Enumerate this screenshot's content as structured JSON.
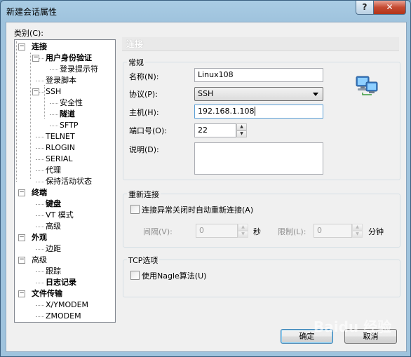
{
  "window": {
    "title": "新建会话属性",
    "help_glyph": "?",
    "close_glyph": "✕"
  },
  "category_label": "类别(C):",
  "tree": {
    "items": [
      {
        "label": "连接",
        "bold": true
      },
      {
        "label": "用户身份验证",
        "bold": true
      },
      {
        "label": "登录提示符",
        "bold": false
      },
      {
        "label": "登录脚本",
        "bold": false
      },
      {
        "label": "SSH",
        "bold": false
      },
      {
        "label": "安全性",
        "bold": false
      },
      {
        "label": "隧道",
        "bold": true
      },
      {
        "label": "SFTP",
        "bold": false
      },
      {
        "label": "TELNET",
        "bold": false
      },
      {
        "label": "RLOGIN",
        "bold": false
      },
      {
        "label": "SERIAL",
        "bold": false
      },
      {
        "label": "代理",
        "bold": false
      },
      {
        "label": "保持活动状态",
        "bold": false
      },
      {
        "label": "终端",
        "bold": true
      },
      {
        "label": "键盘",
        "bold": true
      },
      {
        "label": "VT 模式",
        "bold": false
      },
      {
        "label": "高级",
        "bold": false
      },
      {
        "label": "外观",
        "bold": true
      },
      {
        "label": "边距",
        "bold": false
      },
      {
        "label": "高级",
        "bold": false
      },
      {
        "label": "跟踪",
        "bold": false
      },
      {
        "label": "日志记录",
        "bold": true
      },
      {
        "label": "文件传输",
        "bold": true
      },
      {
        "label": "X/YMODEM",
        "bold": false
      },
      {
        "label": "ZMODEM",
        "bold": false
      }
    ]
  },
  "panel": {
    "heading": "连接",
    "general": {
      "title": "常规",
      "name_label": "名称(N):",
      "name_value": "Linux108",
      "protocol_label": "协议(P):",
      "protocol_value": "SSH",
      "host_label": "主机(H):",
      "host_value": "192.168.1.108",
      "port_label": "端口号(O):",
      "port_value": "22",
      "desc_label": "说明(D):",
      "desc_value": ""
    },
    "reconnect": {
      "title": "重新连接",
      "checkbox_label": "连接异常关闭时自动重新连接(A)",
      "interval_label": "间隔(V):",
      "interval_value": "0",
      "interval_unit": "秒",
      "limit_label": "限制(L):",
      "limit_value": "0",
      "limit_unit": "分钟"
    },
    "tcp": {
      "title": "TCP选项",
      "checkbox_label": "使用Nagle算法(U)"
    }
  },
  "buttons": {
    "ok": "确定",
    "cancel": "取消"
  },
  "watermark": "Baidu 经验"
}
